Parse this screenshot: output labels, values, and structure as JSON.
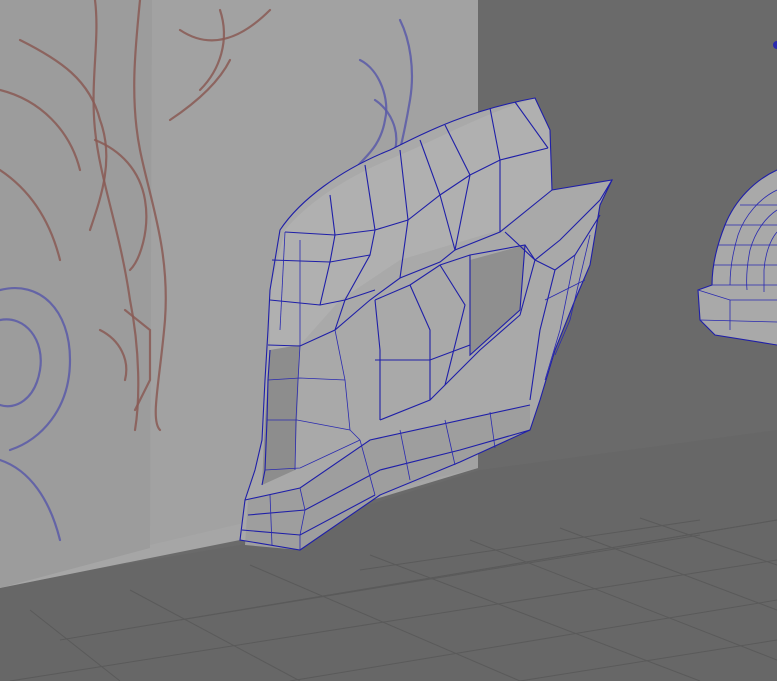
{
  "scene": {
    "background_color": "#6a6a6a",
    "floor_color": "#666666",
    "wall_color": "#a5a5a5",
    "side_wall_color": "#9a9a9a",
    "mesh_color": "#a9a9a9",
    "wireframe_color": "#1f1fa8",
    "sketch_colors": {
      "red": "#8a5a55",
      "blue": "#5a5aa8"
    },
    "objects": [
      "reference-image-plane",
      "helmet-mesh",
      "partial-mesh-right",
      "floor-grid"
    ]
  }
}
